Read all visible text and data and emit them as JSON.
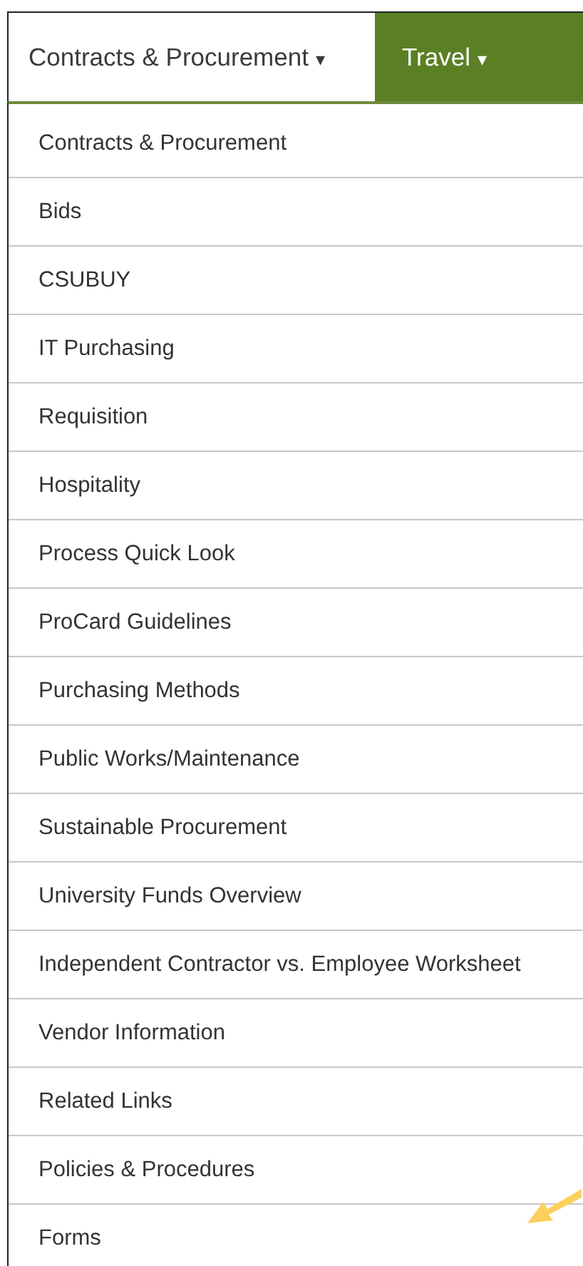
{
  "tabs": [
    {
      "label": "Contracts & Procurement",
      "caret": "▾",
      "selected": true
    },
    {
      "label": "Travel",
      "caret": "▾",
      "selected": false
    }
  ],
  "menu": {
    "items": [
      "Contracts & Procurement",
      "Bids",
      "CSUBUY",
      "IT Purchasing",
      "Requisition",
      "Hospitality",
      "Process Quick Look",
      "ProCard Guidelines",
      "Purchasing Methods",
      "Public Works/Maintenance",
      "Sustainable Procurement",
      "University Funds Overview",
      "Independent Contractor vs. Employee Worksheet",
      "Vendor Information",
      "Related Links",
      "Policies & Procedures",
      "Forms"
    ]
  }
}
